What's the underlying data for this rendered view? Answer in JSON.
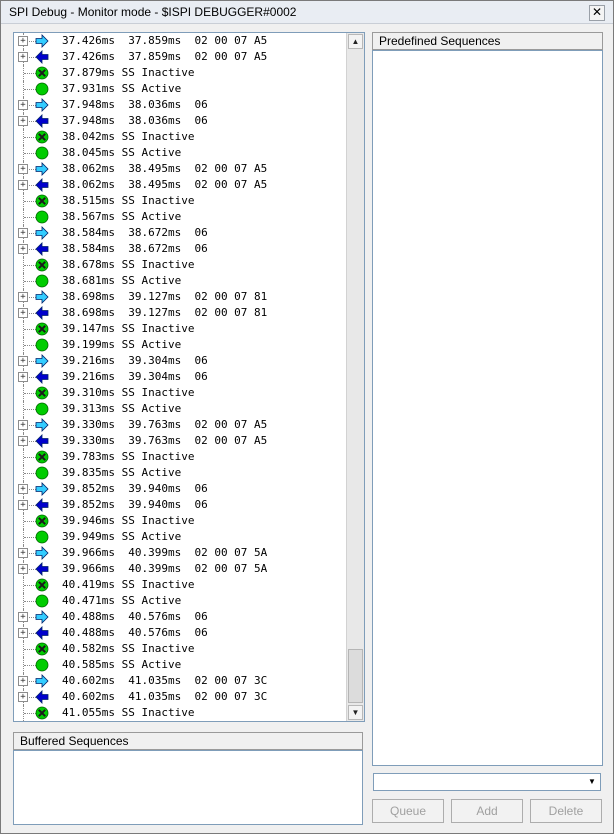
{
  "window": {
    "title": "SPI Debug - Monitor mode - $ISPI DEBUGGER#0002",
    "close_glyph": "✕"
  },
  "log_rows": [
    {
      "kind": "out",
      "text": "37.426ms  37.859ms  02 00 07 A5"
    },
    {
      "kind": "in",
      "text": "37.426ms  37.859ms  02 00 07 A5"
    },
    {
      "kind": "inactive",
      "text": "37.879ms SS Inactive"
    },
    {
      "kind": "active",
      "text": "37.931ms SS Active"
    },
    {
      "kind": "out",
      "text": "37.948ms  38.036ms  06"
    },
    {
      "kind": "in",
      "text": "37.948ms  38.036ms  06"
    },
    {
      "kind": "inactive",
      "text": "38.042ms SS Inactive"
    },
    {
      "kind": "active",
      "text": "38.045ms SS Active"
    },
    {
      "kind": "out",
      "text": "38.062ms  38.495ms  02 00 07 A5"
    },
    {
      "kind": "in",
      "text": "38.062ms  38.495ms  02 00 07 A5"
    },
    {
      "kind": "inactive",
      "text": "38.515ms SS Inactive"
    },
    {
      "kind": "active",
      "text": "38.567ms SS Active"
    },
    {
      "kind": "out",
      "text": "38.584ms  38.672ms  06"
    },
    {
      "kind": "in",
      "text": "38.584ms  38.672ms  06"
    },
    {
      "kind": "inactive",
      "text": "38.678ms SS Inactive"
    },
    {
      "kind": "active",
      "text": "38.681ms SS Active"
    },
    {
      "kind": "out",
      "text": "38.698ms  39.127ms  02 00 07 81"
    },
    {
      "kind": "in",
      "text": "38.698ms  39.127ms  02 00 07 81"
    },
    {
      "kind": "inactive",
      "text": "39.147ms SS Inactive"
    },
    {
      "kind": "active",
      "text": "39.199ms SS Active"
    },
    {
      "kind": "out",
      "text": "39.216ms  39.304ms  06"
    },
    {
      "kind": "in",
      "text": "39.216ms  39.304ms  06"
    },
    {
      "kind": "inactive",
      "text": "39.310ms SS Inactive"
    },
    {
      "kind": "active",
      "text": "39.313ms SS Active"
    },
    {
      "kind": "out",
      "text": "39.330ms  39.763ms  02 00 07 A5"
    },
    {
      "kind": "in",
      "text": "39.330ms  39.763ms  02 00 07 A5"
    },
    {
      "kind": "inactive",
      "text": "39.783ms SS Inactive"
    },
    {
      "kind": "active",
      "text": "39.835ms SS Active"
    },
    {
      "kind": "out",
      "text": "39.852ms  39.940ms  06"
    },
    {
      "kind": "in",
      "text": "39.852ms  39.940ms  06"
    },
    {
      "kind": "inactive",
      "text": "39.946ms SS Inactive"
    },
    {
      "kind": "active",
      "text": "39.949ms SS Active"
    },
    {
      "kind": "out",
      "text": "39.966ms  40.399ms  02 00 07 5A"
    },
    {
      "kind": "in",
      "text": "39.966ms  40.399ms  02 00 07 5A"
    },
    {
      "kind": "inactive",
      "text": "40.419ms SS Inactive"
    },
    {
      "kind": "active",
      "text": "40.471ms SS Active"
    },
    {
      "kind": "out",
      "text": "40.488ms  40.576ms  06"
    },
    {
      "kind": "in",
      "text": "40.488ms  40.576ms  06"
    },
    {
      "kind": "inactive",
      "text": "40.582ms SS Inactive"
    },
    {
      "kind": "active",
      "text": "40.585ms SS Active"
    },
    {
      "kind": "out",
      "text": "40.602ms  41.035ms  02 00 07 3C"
    },
    {
      "kind": "in",
      "text": "40.602ms  41.035ms  02 00 07 3C"
    },
    {
      "kind": "inactive",
      "text": "41.055ms SS Inactive"
    }
  ],
  "icons": {
    "out": "arrow-right-icon",
    "in": "arrow-left-icon",
    "inactive": "ss-inactive-icon",
    "active": "ss-active-icon",
    "expander": "expand-plus-icon"
  },
  "colors": {
    "out_arrow": "#33ccff",
    "in_arrow": "#0000cc",
    "ss_green": "#00cc00",
    "ss_x": "#1a1a1a"
  },
  "scrollbar": {
    "up_glyph": "▲",
    "down_glyph": "▼"
  },
  "expander_glyph": "+",
  "predefined": {
    "header": "Predefined Sequences"
  },
  "buffered": {
    "header": "Buffered Sequences"
  },
  "combo": {
    "value": "",
    "arrow_glyph": "▼"
  },
  "buttons": {
    "queue": "Queue",
    "add": "Add",
    "delete": "Delete"
  }
}
